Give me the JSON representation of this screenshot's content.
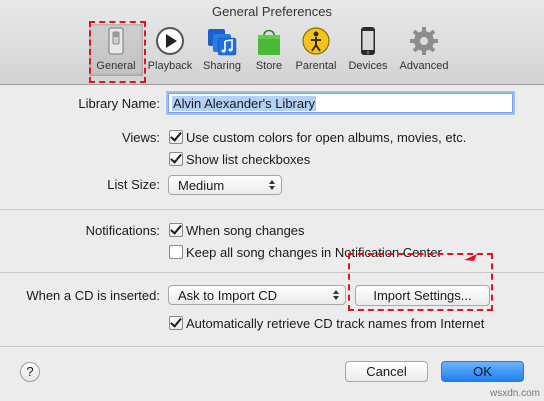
{
  "window": {
    "title": "General Preferences"
  },
  "toolbar": {
    "items": [
      {
        "label": "General",
        "icon": "general-switch-icon",
        "selected": true
      },
      {
        "label": "Playback",
        "icon": "play-icon"
      },
      {
        "label": "Sharing",
        "icon": "music-note-icon"
      },
      {
        "label": "Store",
        "icon": "shopping-bag-icon"
      },
      {
        "label": "Parental",
        "icon": "parental-figure-icon"
      },
      {
        "label": "Devices",
        "icon": "iphone-icon"
      },
      {
        "label": "Advanced",
        "icon": "gear-icon"
      }
    ]
  },
  "general": {
    "library_name_label": "Library Name:",
    "library_name_value": "Alvin Alexander's Library",
    "views_label": "Views:",
    "views_options": [
      {
        "label": "Use custom colors for open albums, movies, etc.",
        "checked": true
      },
      {
        "label": "Show list checkboxes",
        "checked": true
      }
    ],
    "list_size_label": "List Size:",
    "list_size_value": "Medium",
    "notifications_label": "Notifications:",
    "notification_options": [
      {
        "label": "When song changes",
        "checked": true
      },
      {
        "label": "Keep all song changes in Notification Center",
        "checked": false
      }
    ],
    "cd_label": "When a CD is inserted:",
    "cd_action_value": "Ask to Import CD",
    "import_settings_label": "Import Settings...",
    "auto_retrieve_label": "Automatically retrieve CD track names from Internet",
    "auto_retrieve_checked": true
  },
  "footer": {
    "help_label": "?",
    "cancel_label": "Cancel",
    "ok_label": "OK"
  },
  "watermark": "wsxdn.com",
  "colors": {
    "accent": "#1e7ff2",
    "highlight_box": "#e0161c",
    "selection": "#b3d1f5"
  }
}
